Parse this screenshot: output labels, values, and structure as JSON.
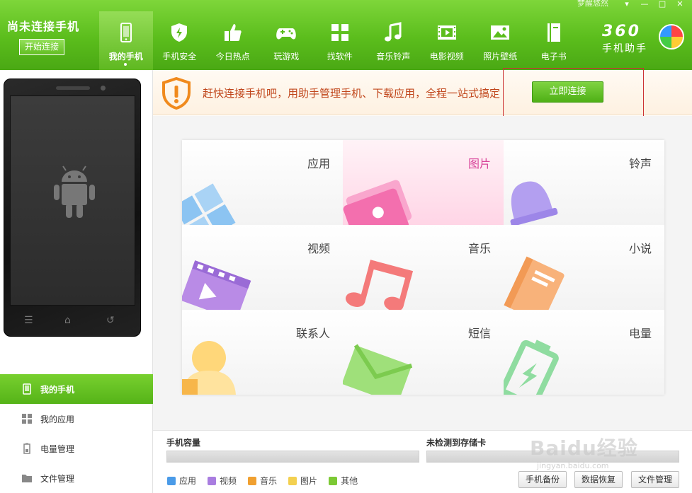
{
  "header": {
    "status_title": "尚未连接手机",
    "connect_button": "开始连接",
    "user_name": "梦醒悠然",
    "window_controls": [
      "▾",
      "—",
      "□",
      "✕"
    ],
    "brand_number": "360",
    "brand_sub": "手机助手"
  },
  "nav": [
    {
      "label": "我的手机",
      "icon": "phone-icon",
      "active": true
    },
    {
      "label": "手机安全",
      "icon": "shield-icon",
      "active": false
    },
    {
      "label": "今日热点",
      "icon": "thumbs-up-icon",
      "active": false
    },
    {
      "label": "玩游戏",
      "icon": "gamepad-icon",
      "active": false
    },
    {
      "label": "找软件",
      "icon": "apps-grid-icon",
      "active": false
    },
    {
      "label": "音乐铃声",
      "icon": "music-note-icon",
      "active": false
    },
    {
      "label": "电影视频",
      "icon": "film-icon",
      "active": false
    },
    {
      "label": "照片壁纸",
      "icon": "picture-icon",
      "active": false
    },
    {
      "label": "电子书",
      "icon": "book-icon",
      "active": false
    }
  ],
  "notice": {
    "text": "赶快连接手机吧，用助手管理手机、下载应用，全程一站式搞定",
    "button": "立即连接"
  },
  "tiles": [
    {
      "label": "应用",
      "icon": "apps-icon"
    },
    {
      "label": "图片",
      "icon": "photos-icon",
      "highlight": true
    },
    {
      "label": "铃声",
      "icon": "bell-icon"
    },
    {
      "label": "视频",
      "icon": "video-icon"
    },
    {
      "label": "音乐",
      "icon": "music-icon"
    },
    {
      "label": "小说",
      "icon": "novel-icon"
    },
    {
      "label": "联系人",
      "icon": "contact-icon"
    },
    {
      "label": "短信",
      "icon": "sms-icon"
    },
    {
      "label": "电量",
      "icon": "battery-icon"
    }
  ],
  "sidebar": {
    "items": [
      {
        "label": "我的手机",
        "icon": "phone-icon",
        "active": true
      },
      {
        "label": "我的应用",
        "icon": "apps-grid-icon"
      },
      {
        "label": "电量管理",
        "icon": "battery-icon"
      },
      {
        "label": "文件管理",
        "icon": "folder-icon"
      }
    ]
  },
  "storage": {
    "phone_capacity_label": "手机容量",
    "sd_card_label": "未检测到存储卡",
    "legend": [
      {
        "label": "应用",
        "color": "#4a9be8"
      },
      {
        "label": "视频",
        "color": "#a97de0"
      },
      {
        "label": "音乐",
        "color": "#f0a030"
      },
      {
        "label": "图片",
        "color": "#f3d050"
      },
      {
        "label": "其他",
        "color": "#7cc934"
      }
    ],
    "buttons": [
      "手机备份",
      "数据恢复",
      "文件管理"
    ]
  },
  "watermark": {
    "text": "Baidu经验",
    "url": "jingyan.baidu.com"
  }
}
